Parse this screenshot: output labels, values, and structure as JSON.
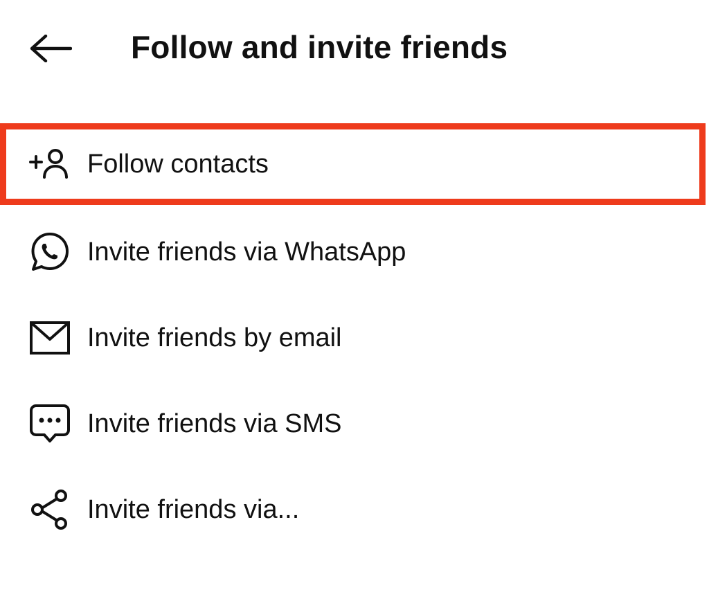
{
  "header": {
    "back_icon": "arrow-left-icon",
    "title": "Follow and invite friends"
  },
  "menu": {
    "highlight_color": "#ee3b1c",
    "items": [
      {
        "label": "Follow contacts",
        "icon": "add-person-icon",
        "highlighted": true
      },
      {
        "label": "Invite friends via WhatsApp",
        "icon": "whatsapp-icon"
      },
      {
        "label": "Invite friends by email",
        "icon": "envelope-icon"
      },
      {
        "label": "Invite friends via SMS",
        "icon": "message-bubble-icon"
      },
      {
        "label": "Invite friends via...",
        "icon": "share-icon"
      }
    ]
  }
}
